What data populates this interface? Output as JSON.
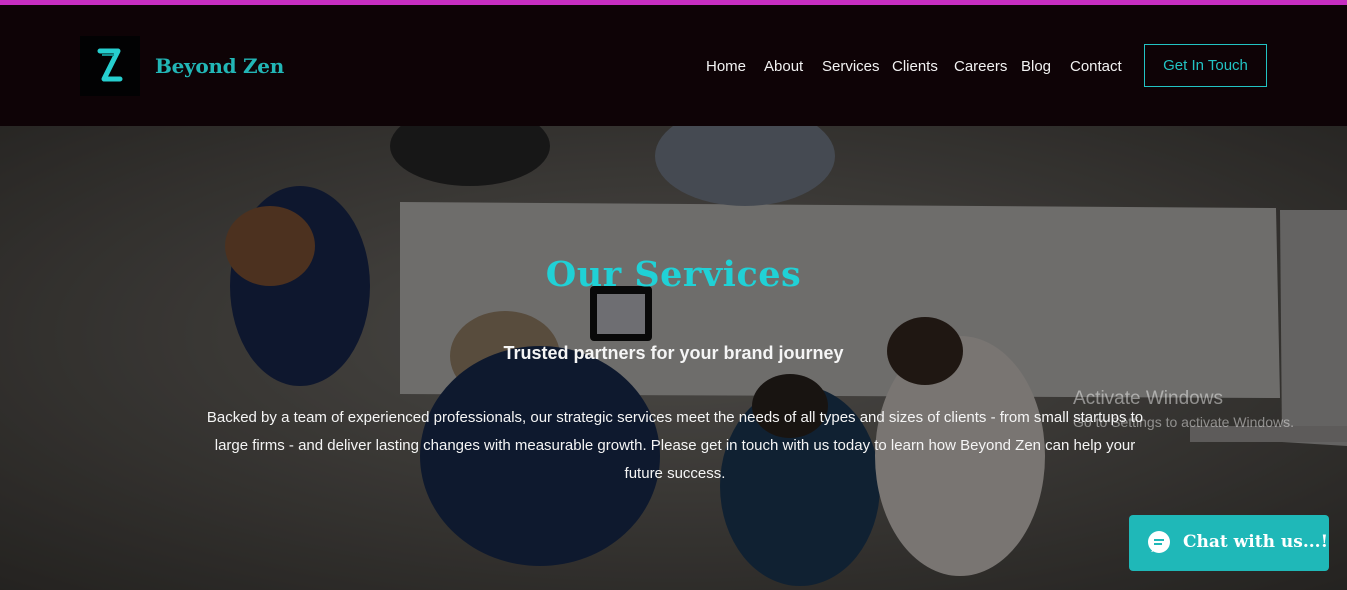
{
  "header": {
    "brand_name": "Beyond Zen",
    "logo_icon": "z-logo-icon",
    "nav": [
      {
        "label": "Home"
      },
      {
        "label": "About"
      },
      {
        "label": "Services"
      },
      {
        "label": "Clients"
      },
      {
        "label": "Careers"
      },
      {
        "label": "Blog"
      },
      {
        "label": "Contact"
      }
    ],
    "cta_label": "Get In Touch"
  },
  "hero": {
    "title": "Our Services",
    "subtitle": "Trusted partners for your brand journey",
    "body": "Backed by a team of experienced professionals, our strategic services meet the needs of all types and sizes of clients - from small startups to large firms - and deliver lasting changes with measurable growth. Please get in touch with us today to learn how Beyond Zen can help your future success."
  },
  "watermark": {
    "line1": "Activate Windows",
    "line2": "Go to Settings to activate Windows."
  },
  "chat": {
    "label": "Chat with us...!",
    "icon": "chat-bubble-icon"
  },
  "colors": {
    "accent": "#22c3c3",
    "header_bg": "#0e0306",
    "top_strip": "#c62ec0",
    "chat_bg": "#1fb8b8"
  }
}
